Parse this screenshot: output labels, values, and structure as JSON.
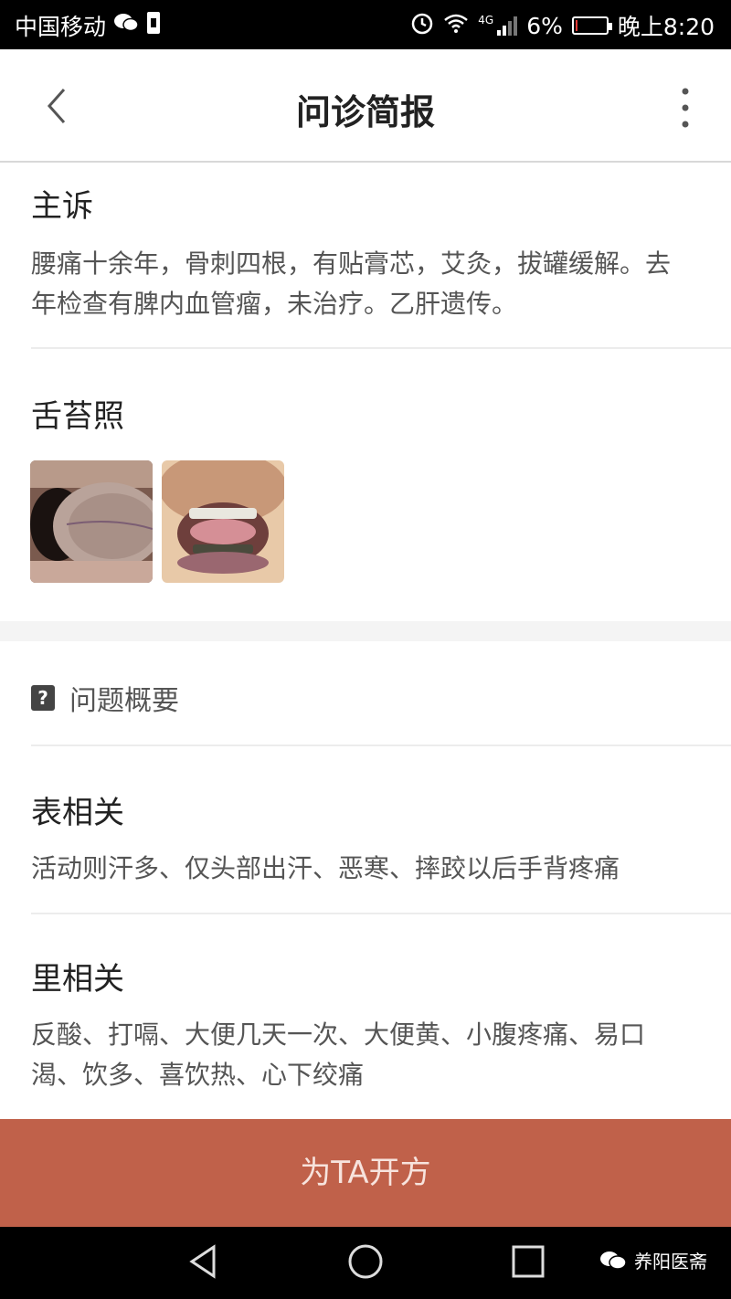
{
  "status_bar": {
    "carrier": "中国移动",
    "network": "4G",
    "battery_percent": "6%",
    "battery_level": 0.06,
    "time": "晚上8:20",
    "icons": [
      "wechat-icon",
      "sim-icon",
      "alarm-icon",
      "wifi-icon",
      "signal-icon",
      "battery-icon"
    ]
  },
  "header": {
    "title": "问诊简报",
    "back_icon": "chevron-left-icon",
    "more_icon": "more-vertical-icon"
  },
  "chief_complaint": {
    "heading": "主诉",
    "text": "腰痛十余年，骨刺四根，有贴膏芯，艾灸，拔罐缓解。去年检查有脾内血管瘤，未治疗。乙肝遗传。"
  },
  "tongue_photos": {
    "heading": "舌苔照",
    "images": [
      "tongue-photo-1",
      "tongue-photo-2"
    ]
  },
  "overview": {
    "icon": "question-icon",
    "label": "问题概要"
  },
  "exterior": {
    "heading": "表相关",
    "text": "活动则汗多、仅头部出汗、恶寒、摔跤以后手背疼痛"
  },
  "interior": {
    "heading": "里相关",
    "text": "反酸、打嗝、大便几天一次、大便黄、小腹疼痛、易口渴、饮多、喜饮热、心下绞痛"
  },
  "cta": {
    "label": "为TA开方"
  },
  "nav_bar": {
    "icons": [
      "back-triangle-icon",
      "home-circle-icon",
      "recents-square-icon"
    ],
    "watermark": "养阳医斋"
  },
  "colors": {
    "cta_bg": "#c0614a",
    "cta_text": "#f7e3dd",
    "battery_low": "#e53935"
  }
}
